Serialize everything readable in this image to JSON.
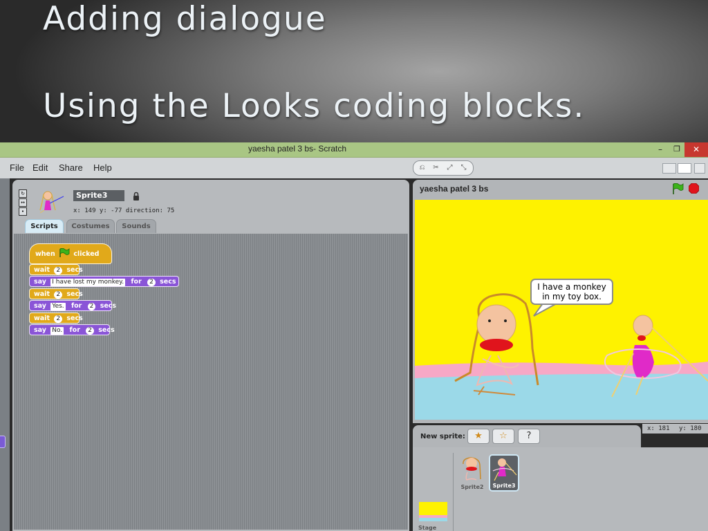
{
  "slide": {
    "title": "Adding dialogue",
    "subtitle": "Using the Looks coding blocks."
  },
  "window": {
    "title": "yaesha patel 3 bs- Scratch",
    "minimize": "–",
    "maximize": "❐",
    "close": "✕"
  },
  "menu": {
    "items": [
      "File",
      "Edit",
      "Share",
      "Help"
    ]
  },
  "sprite_info": {
    "name": "Sprite3",
    "coords": "x: 149  y: -77  direction: 75"
  },
  "tabs": [
    "Scripts",
    "Costumes",
    "Sounds"
  ],
  "script": {
    "hat": {
      "when": "when",
      "clicked": "clicked"
    },
    "wait": "wait",
    "secs": "secs",
    "say": "say",
    "for": "for",
    "wait_value": "2",
    "say_duration": "2",
    "lines": [
      "I have lost my monkey.",
      "Yes.",
      "No."
    ]
  },
  "stage": {
    "title": "yaesha patel 3 bs",
    "speech_line1": "I have a monkey",
    "speech_line2": "in my toy box.",
    "mouse_x": "x: 181",
    "mouse_y": "y: 180"
  },
  "corral": {
    "new_sprite_label": "New sprite:",
    "sprites": [
      "Sprite2",
      "Sprite3"
    ],
    "selected": "Sprite3",
    "stage_label": "Stage"
  },
  "colors": {
    "control_block": "#e1a91a",
    "looks_block": "#8a55d7",
    "stage_background": "#fef200",
    "titlebar": "#a9c684",
    "close_button": "#c7372f"
  }
}
